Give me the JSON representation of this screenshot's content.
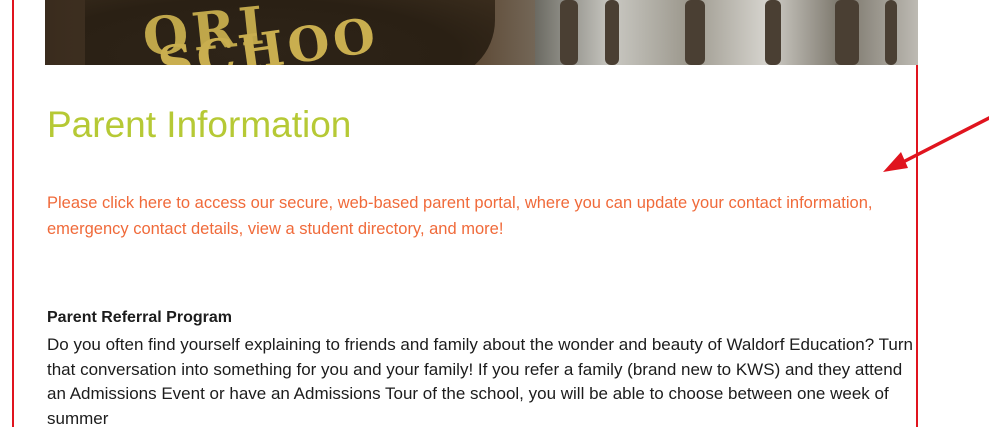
{
  "page": {
    "title": "Parent Information",
    "portal_link_text": "Please click here to access our secure, web-based parent portal, where you can update your contact information, emergency contact details, view a student directory, and more!",
    "referral": {
      "heading": "Parent Referral Program",
      "body": "Do you often find yourself explaining to friends and family about the wonder and beauty of Waldorf Education? Turn that conversation into something for you and your family! If you refer a family (brand new to KWS) and they attend an Admissions Event or have an Admissions Tour of the school, you will be able to choose between one week of summer"
    }
  },
  "hero": {
    "sign_line_1": "ORI",
    "sign_line_2": "SCHOO"
  },
  "colors": {
    "title": "#b6c935",
    "link": "#f06a3a",
    "frame_border": "#e0141e",
    "annotation_arrow": "#e0141e",
    "body_text": "#1c1c1c"
  }
}
